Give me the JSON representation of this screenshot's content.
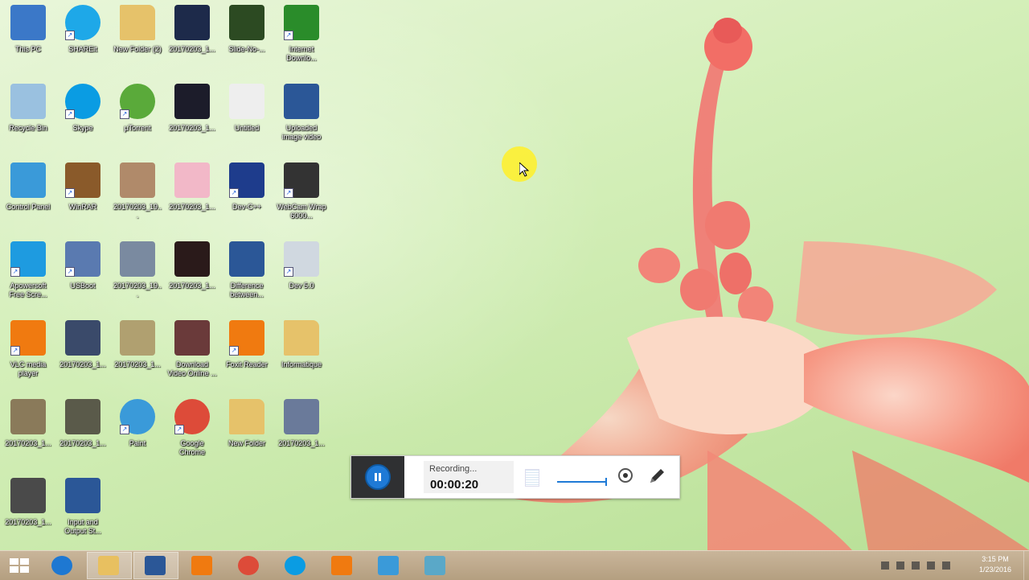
{
  "desktop_icons": [
    {
      "label": "This PC",
      "icon": "computer-icon",
      "color": "#3b78c8",
      "shortcut": false
    },
    {
      "label": "SHAREit",
      "icon": "shareit-icon",
      "color": "#1ea8e8",
      "shortcut": true
    },
    {
      "label": "New Folder (2)",
      "icon": "folder-icon",
      "color": "#e6c26a",
      "shortcut": false
    },
    {
      "label": "20170203_1...",
      "icon": "image-icon",
      "color": "#1d2a4a",
      "shortcut": false
    },
    {
      "label": "Slide-No-...",
      "icon": "image-icon",
      "color": "#2c4a22",
      "shortcut": false
    },
    {
      "label": "Internet Downlo...",
      "icon": "idm-icon",
      "color": "#2a8c2a",
      "shortcut": true
    },
    {
      "label": "Recycle Bin",
      "icon": "recycle-bin-icon",
      "color": "#9ac1e0",
      "shortcut": false
    },
    {
      "label": "Skype",
      "icon": "skype-icon",
      "color": "#0a9ce3",
      "shortcut": true
    },
    {
      "label": "µTorrent",
      "icon": "utorrent-icon",
      "color": "#5aaa3a",
      "shortcut": true
    },
    {
      "label": "20170203_1...",
      "icon": "image-icon",
      "color": "#1c1c2a",
      "shortcut": false
    },
    {
      "label": "Untitled",
      "icon": "text-file-icon",
      "color": "#eeeeee",
      "shortcut": false
    },
    {
      "label": "Uploaded image video",
      "icon": "word-doc-icon",
      "color": "#2b5797",
      "shortcut": false
    },
    {
      "label": "Control Panel",
      "icon": "control-panel-icon",
      "color": "#3a9ad9",
      "shortcut": false
    },
    {
      "label": "WinRAR",
      "icon": "winrar-icon",
      "color": "#8a5a2a",
      "shortcut": true
    },
    {
      "label": "20170203_19...",
      "icon": "image-icon",
      "color": "#b08a6a",
      "shortcut": false
    },
    {
      "label": "20170203_1...",
      "icon": "image-icon",
      "color": "#f2b8c8",
      "shortcut": false
    },
    {
      "label": "Dev-C++",
      "icon": "devcpp-icon",
      "color": "#1e3c8c",
      "shortcut": true
    },
    {
      "label": "WebCam Wrap 6000...",
      "icon": "camera-icon",
      "color": "#333333",
      "shortcut": true
    },
    {
      "label": "Apowersoft Free Scre...",
      "icon": "recorder-icon",
      "color": "#1e9be0",
      "shortcut": true
    },
    {
      "label": "USBoot",
      "icon": "usboot-icon",
      "color": "#5a7ab0",
      "shortcut": true
    },
    {
      "label": "20170203_19...",
      "icon": "image-icon",
      "color": "#7a8aa0",
      "shortcut": false
    },
    {
      "label": "20170203_1...",
      "icon": "image-icon",
      "color": "#2a1a1a",
      "shortcut": false
    },
    {
      "label": "Difference between...",
      "icon": "word-doc-icon",
      "color": "#2b5797",
      "shortcut": false
    },
    {
      "label": "Dev 5.0",
      "icon": "app-icon",
      "color": "#d0d8e0",
      "shortcut": true
    },
    {
      "label": "VLC media player",
      "icon": "vlc-icon",
      "color": "#f07a10",
      "shortcut": true
    },
    {
      "label": "20170203_1...",
      "icon": "image-icon",
      "color": "#3a4a6a",
      "shortcut": false
    },
    {
      "label": "20170203_1...",
      "icon": "image-icon",
      "color": "#b0a070",
      "shortcut": false
    },
    {
      "label": "Download Video Online ...",
      "icon": "image-icon",
      "color": "#6a3a3a",
      "shortcut": false
    },
    {
      "label": "Foxit Reader",
      "icon": "foxit-icon",
      "color": "#f07a10",
      "shortcut": true
    },
    {
      "label": "Informatique",
      "icon": "folder-icon",
      "color": "#e6c26a",
      "shortcut": false
    },
    {
      "label": "20170203_1...",
      "icon": "image-icon",
      "color": "#8a7a5a",
      "shortcut": false
    },
    {
      "label": "20170203_1...",
      "icon": "image-icon",
      "color": "#5a5a4a",
      "shortcut": false
    },
    {
      "label": "Paint",
      "icon": "paint-icon",
      "color": "#3a9ad9",
      "shortcut": true
    },
    {
      "label": "Google Chrome",
      "icon": "chrome-icon",
      "color": "#dd4b39",
      "shortcut": true
    },
    {
      "label": "New Folder",
      "icon": "folder-icon",
      "color": "#e6c26a",
      "shortcut": false
    },
    {
      "label": "20170203_1...",
      "icon": "image-icon",
      "color": "#6a7a9a",
      "shortcut": false
    },
    {
      "label": "20170203_1...",
      "icon": "image-icon",
      "color": "#4a4a4a",
      "shortcut": false
    },
    {
      "label": "Input and Output St...",
      "icon": "word-doc-icon",
      "color": "#2b5797",
      "shortcut": false
    }
  ],
  "recorder": {
    "status": "Recording...",
    "time": "00:00:20",
    "accent": "#1f7ad6"
  },
  "taskbar": {
    "start_icon": "windows-logo-icon",
    "pinned": [
      {
        "name": "internet-explorer-icon",
        "color": "#1e78d2",
        "active": false
      },
      {
        "name": "file-explorer-icon",
        "color": "#e8c060",
        "active": true
      },
      {
        "name": "word-icon",
        "color": "#2b5797",
        "active": true
      },
      {
        "name": "vlc-icon",
        "color": "#f07a10",
        "active": false
      },
      {
        "name": "chrome-icon",
        "color": "#dd4b39",
        "active": false
      },
      {
        "name": "skype-icon",
        "color": "#0a9ce3",
        "active": false
      },
      {
        "name": "foxit-icon",
        "color": "#f07a10",
        "active": false
      },
      {
        "name": "remote-desktop-icon",
        "color": "#3a9ad9",
        "active": false
      },
      {
        "name": "paint-icon",
        "color": "#5aa8c8",
        "active": false
      }
    ],
    "clock_time": "3:15 PM",
    "clock_date": "1/23/2016"
  }
}
